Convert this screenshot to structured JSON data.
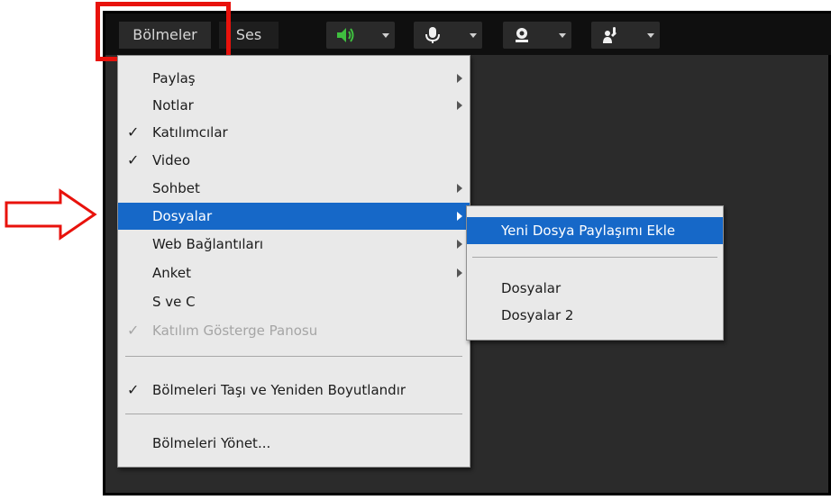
{
  "toolbar": {
    "panes_label": "Bölmeler",
    "audio_label": "Ses",
    "tools": [
      {
        "icon": "speaker-icon",
        "color": "#3fbf3f"
      },
      {
        "icon": "microphone-icon"
      },
      {
        "icon": "webcam-icon"
      },
      {
        "icon": "raise-hand-icon"
      }
    ]
  },
  "pods_menu": {
    "items": [
      {
        "label": "Paylaş",
        "checked": false,
        "submenu": true
      },
      {
        "label": "Notlar",
        "checked": false,
        "submenu": true
      },
      {
        "label": "Katılımcılar",
        "checked": true,
        "submenu": false
      },
      {
        "label": "Video",
        "checked": true,
        "submenu": false
      },
      {
        "label": "Sohbet",
        "checked": false,
        "submenu": true
      },
      {
        "label": "Dosyalar",
        "checked": false,
        "submenu": true,
        "highlighted": true
      },
      {
        "label": "Web Bağlantıları",
        "checked": false,
        "submenu": true
      },
      {
        "label": "Anket",
        "checked": false,
        "submenu": true
      },
      {
        "label": "S ve C",
        "checked": false,
        "submenu": false
      },
      {
        "label": "Katılım Gösterge Panosu",
        "checked": true,
        "submenu": false,
        "disabled": true
      }
    ],
    "move_resize_label": "Bölmeleri Taşı ve Yeniden Boyutlandır",
    "move_resize_checked": true,
    "manage_label": "Bölmeleri Yönet..."
  },
  "files_submenu": {
    "add_new_label": "Yeni Dosya Paylaşımı Ekle",
    "items": [
      "Dosyalar",
      "Dosyalar 2"
    ]
  },
  "check_mark": "✓",
  "colors": {
    "highlight_blue": "#1668c8",
    "annotation_red": "#e8120c"
  }
}
